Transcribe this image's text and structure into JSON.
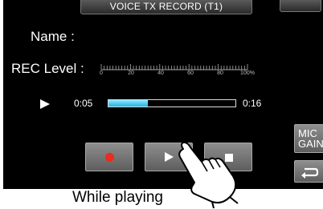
{
  "screen": {
    "title": "VOICE TX RECORD (T1)",
    "name_label": "Name :",
    "rec_level_label": "REC Level :",
    "level_scale": [
      "0",
      "20",
      "40",
      "60",
      "80",
      "100%"
    ]
  },
  "playback": {
    "elapsed": "0:05",
    "total": "0:16",
    "progress_fraction": 0.3125
  },
  "controls": {
    "mic_gain_line1": "MIC",
    "mic_gain_line2": "GAIN",
    "record_color": "#ee2a1a"
  },
  "caption": "While playing"
}
